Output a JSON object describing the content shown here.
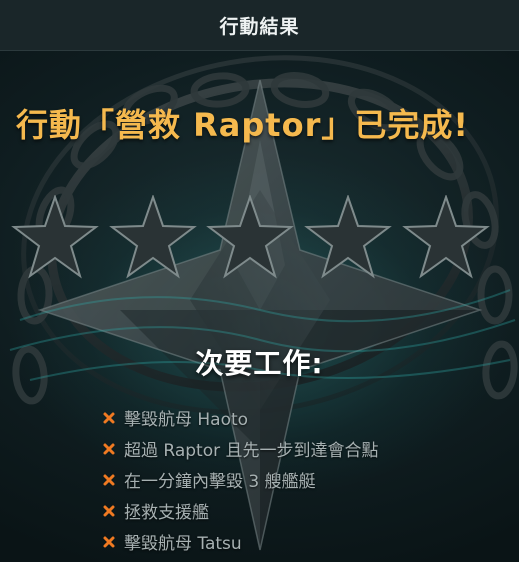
{
  "header": {
    "title": "行動結果"
  },
  "result": {
    "headline": "行動「營救 Raptor」已完成!",
    "stars_earned": 0,
    "stars_total": 5
  },
  "secondary": {
    "title": "次要工作:",
    "tasks": [
      {
        "label": "擊毀航母 Haoto",
        "status": "failed",
        "icon": "x-icon"
      },
      {
        "label": "超過 Raptor 且先一步到達會合點",
        "status": "failed",
        "icon": "x-icon"
      },
      {
        "label": "在一分鐘內擊毀 3 艘艦艇",
        "status": "failed",
        "icon": "x-icon"
      },
      {
        "label": "拯救支援艦",
        "status": "failed",
        "icon": "x-icon"
      },
      {
        "label": "擊毀航母 Tatsu",
        "status": "failed",
        "icon": "x-icon"
      }
    ]
  },
  "colors": {
    "headline": "#f5b94e",
    "fail_icon": "#f07a22",
    "task_text": "#a7b1b2",
    "header_bg": "#1a2629"
  }
}
